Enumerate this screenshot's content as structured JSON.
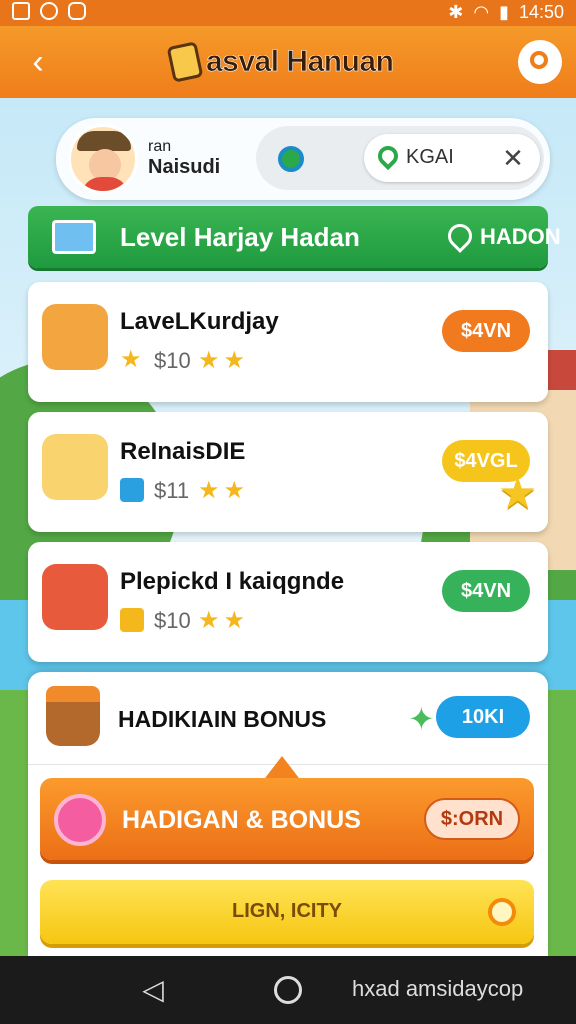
{
  "status_bar": {
    "time": "14:50"
  },
  "app_bar": {
    "title": "asval Hanuan"
  },
  "profile": {
    "label_small": "ran",
    "name": "Naisudi",
    "location_text": "KGAI"
  },
  "level_banner": {
    "title": "Level Harjay Hadan",
    "right_text": "HADON"
  },
  "items": [
    {
      "title": "LaveLKurdjay",
      "value": "$10",
      "stars": "★★",
      "badge": "$4VN",
      "badge_color": "#f07a1d",
      "thumb_color": "#f3a640"
    },
    {
      "title": "ReInaisDIE",
      "value": "$11",
      "stars": "★★",
      "badge": "$4VGL",
      "badge_color": "#f5c51b",
      "thumb_color": "#f8d36e"
    },
    {
      "title": "Plepickd I kaiqgnde",
      "value": "$10",
      "stars": "★★",
      "badge": "$4VN",
      "badge_color": "#36b25a",
      "thumb_color": "#e85a3c"
    }
  ],
  "bonus_panel": {
    "title": "HADIKIAIN BONUS",
    "badge": "10KI",
    "button_label": "HADIGAN & BONUS",
    "button_badge": "$:ORN",
    "secondary_label": "LIGN, ICITY"
  },
  "nav_bar": {
    "text": "hxad amsidaycop"
  },
  "colors": {
    "accent": "#ef7d1a",
    "banner_green": "#2aa84a",
    "info_blue": "#1ea0e6",
    "yellow": "#f6c611"
  }
}
